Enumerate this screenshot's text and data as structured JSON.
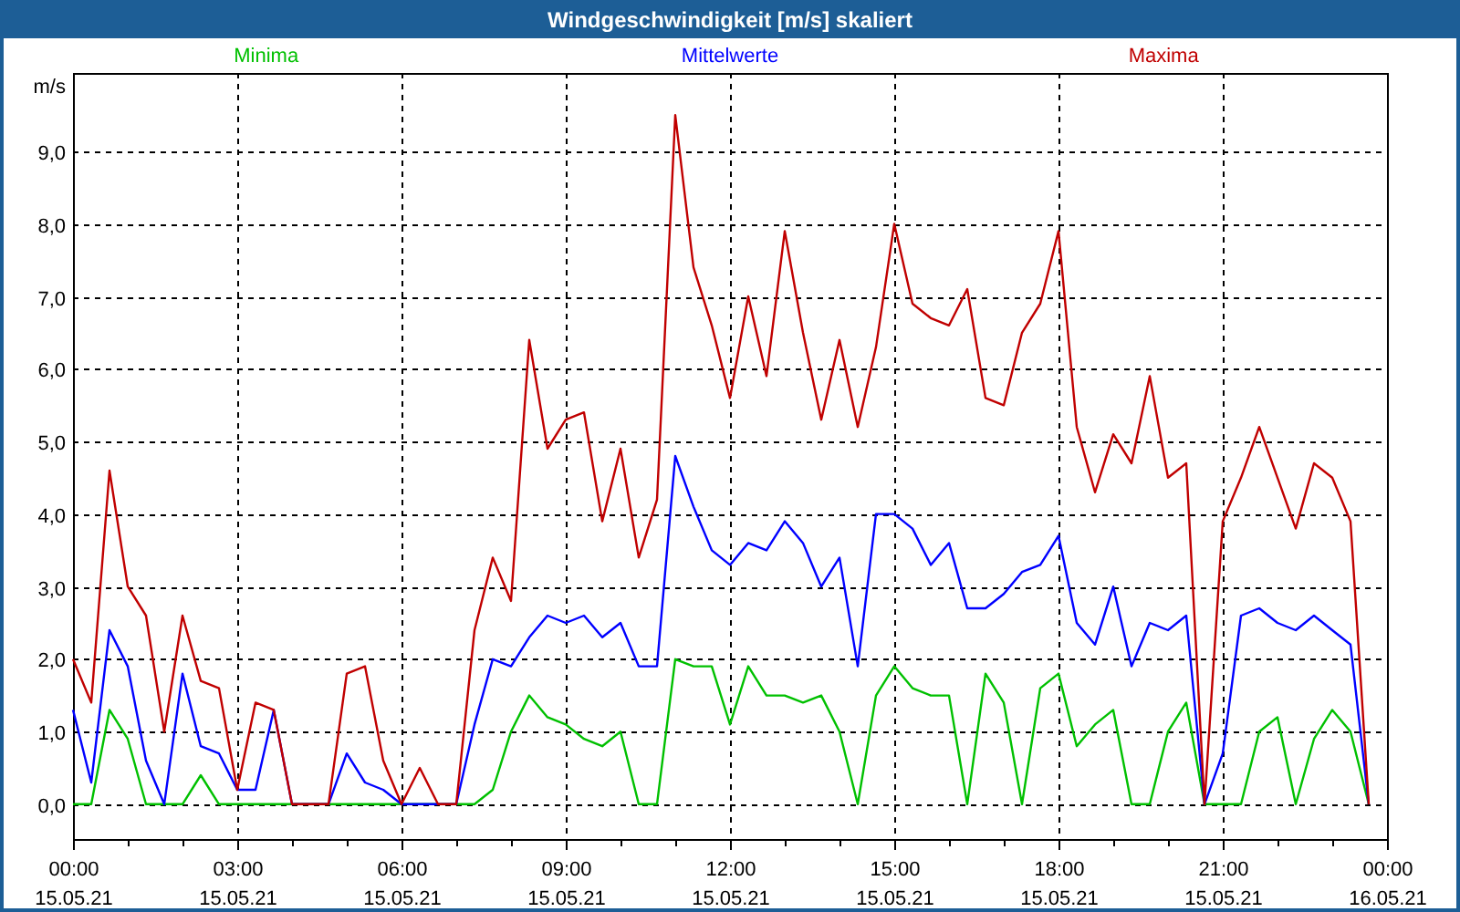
{
  "window": {
    "title": "Windgeschwindigkeit [m/s] skaliert"
  },
  "chart_data": {
    "type": "line",
    "grid": true,
    "ylabel": "m/s",
    "ylim": [
      -0.48,
      10.08
    ],
    "categories": [
      "00:00\n15.05.21",
      null,
      null,
      null,
      null,
      null,
      null,
      null,
      null,
      "03:00\n15.05.21",
      null,
      null,
      null,
      null,
      null,
      null,
      null,
      null,
      "06:00\n15.05.21",
      null,
      null,
      null,
      null,
      null,
      null,
      null,
      null,
      "09:00\n15.05.21",
      null,
      null,
      null,
      null,
      null,
      null,
      null,
      null,
      "12:00\n15.05.21",
      null,
      null,
      null,
      null,
      null,
      null,
      null,
      null,
      "15:00\n15.05.21",
      null,
      null,
      null,
      null,
      null,
      null,
      null,
      null,
      "18:00\n15.05.21",
      null,
      null,
      null,
      null,
      null,
      null,
      null,
      null,
      "21:00\n15.05.21",
      null,
      null,
      null,
      null,
      null,
      null,
      null,
      null,
      "00:00\n16.05.21"
    ],
    "yticks": [
      {
        "value": 0,
        "label": "0,0"
      },
      {
        "value": 1,
        "label": "1,0"
      },
      {
        "value": 2,
        "label": "2,0"
      },
      {
        "value": 3,
        "label": "3,0"
      },
      {
        "value": 4,
        "label": "4,0"
      },
      {
        "value": 5,
        "label": "5,0"
      },
      {
        "value": 6,
        "label": "6,0"
      },
      {
        "value": 7,
        "label": "7,0"
      },
      {
        "value": 8,
        "label": "8,0"
      },
      {
        "value": 9,
        "label": "9,0"
      }
    ],
    "series": [
      {
        "name": "Minima",
        "color": "#00c000",
        "values": [
          0,
          0,
          1.3,
          0.9,
          0,
          0,
          0,
          0.4,
          0,
          0,
          0,
          0,
          0,
          0,
          0,
          0,
          0,
          0,
          0,
          0,
          0,
          0,
          0,
          0.2,
          1.0,
          1.5,
          1.2,
          1.1,
          0.9,
          0.8,
          1.0,
          0,
          0,
          2.0,
          1.9,
          1.9,
          1.1,
          1.9,
          1.5,
          1.5,
          1.4,
          1.5,
          1.0,
          0,
          1.5,
          1.9,
          1.6,
          1.5,
          1.5,
          0,
          1.8,
          1.4,
          0,
          1.6,
          1.8,
          0.8,
          1.1,
          1.3,
          0,
          0,
          1.0,
          1.4,
          0,
          0,
          0,
          1.0,
          1.2,
          0,
          0.9,
          1.3,
          1.0,
          0,
          null
        ]
      },
      {
        "name": "Mittelwerte",
        "color": "#0000ff",
        "values": [
          1.3,
          0.3,
          2.4,
          1.9,
          0.6,
          0,
          1.8,
          0.8,
          0.7,
          0.2,
          0.2,
          1.3,
          0,
          0,
          0,
          0.7,
          0.3,
          0.2,
          0,
          0,
          0,
          0,
          1.1,
          2.0,
          1.9,
          2.3,
          2.6,
          2.5,
          2.6,
          2.3,
          2.5,
          1.9,
          1.9,
          4.8,
          4.1,
          3.5,
          3.3,
          3.6,
          3.5,
          3.9,
          3.6,
          3.0,
          3.4,
          1.9,
          4.0,
          4.0,
          3.8,
          3.3,
          3.6,
          2.7,
          2.7,
          2.9,
          3.2,
          3.3,
          3.7,
          2.5,
          2.2,
          3.0,
          1.9,
          2.5,
          2.4,
          2.6,
          0,
          0.7,
          2.6,
          2.7,
          2.5,
          2.4,
          2.6,
          2.4,
          2.2,
          0,
          null
        ]
      },
      {
        "name": "Maxima",
        "color": "#c00000",
        "values": [
          2.0,
          1.4,
          4.6,
          3.0,
          2.6,
          1.0,
          2.6,
          1.7,
          1.6,
          0.2,
          1.4,
          1.3,
          0,
          0,
          0,
          1.8,
          1.9,
          0.6,
          0,
          0.5,
          0,
          0,
          2.4,
          3.4,
          2.8,
          6.4,
          4.9,
          5.3,
          5.4,
          3.9,
          4.9,
          3.4,
          4.2,
          9.5,
          7.4,
          6.6,
          5.6,
          7.0,
          5.9,
          7.9,
          6.5,
          5.3,
          6.4,
          5.2,
          6.3,
          8.0,
          6.9,
          6.7,
          6.6,
          7.1,
          5.6,
          5.5,
          6.5,
          6.9,
          7.9,
          5.2,
          4.3,
          5.1,
          4.7,
          5.9,
          4.5,
          4.7,
          0,
          3.9,
          4.5,
          5.2,
          4.5,
          3.8,
          4.7,
          4.5,
          3.9,
          0,
          null
        ]
      }
    ]
  }
}
